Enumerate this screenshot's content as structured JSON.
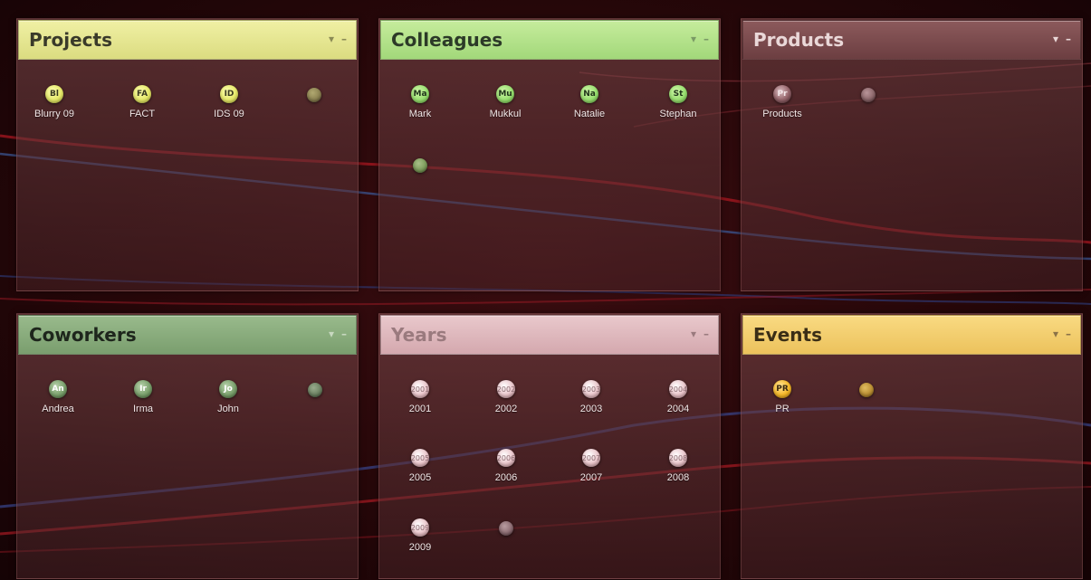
{
  "colors": {
    "projects": "#e6e68c",
    "colleagues": "#b2e28a",
    "products": "#7c4a4d",
    "coworkers": "#88ab7b",
    "years": "#ddb8bd",
    "events": "#f3cc6a"
  },
  "controls": {
    "dropdown_icon": "▾",
    "minimize_icon": "–"
  },
  "panels": {
    "projects": {
      "title": "Projects",
      "items": [
        {
          "abbr": "Bl",
          "label": "Blurry 09"
        },
        {
          "abbr": "FA",
          "label": "FACT"
        },
        {
          "abbr": "ID",
          "label": "IDS 09"
        }
      ]
    },
    "colleagues": {
      "title": "Colleagues",
      "items": [
        {
          "abbr": "Ma",
          "label": "Mark"
        },
        {
          "abbr": "Mu",
          "label": "Mukkul"
        },
        {
          "abbr": "Na",
          "label": "Natalie"
        },
        {
          "abbr": "St",
          "label": "Stephan"
        }
      ]
    },
    "products": {
      "title": "Products",
      "items": [
        {
          "abbr": "Pr",
          "label": "Products"
        }
      ]
    },
    "coworkers": {
      "title": "Coworkers",
      "items": [
        {
          "abbr": "An",
          "label": "Andrea"
        },
        {
          "abbr": "Ir",
          "label": "Irma"
        },
        {
          "abbr": "Jo",
          "label": "John"
        }
      ]
    },
    "years": {
      "title": "Years",
      "items": [
        {
          "abbr": "2001",
          "label": "2001"
        },
        {
          "abbr": "2002",
          "label": "2002"
        },
        {
          "abbr": "2003",
          "label": "2003"
        },
        {
          "abbr": "2004",
          "label": "2004"
        },
        {
          "abbr": "2005",
          "label": "2005"
        },
        {
          "abbr": "2006",
          "label": "2006"
        },
        {
          "abbr": "2007",
          "label": "2007"
        },
        {
          "abbr": "2008",
          "label": "2008"
        },
        {
          "abbr": "2009",
          "label": "2009"
        }
      ]
    },
    "events": {
      "title": "Events",
      "items": [
        {
          "abbr": "PR",
          "label": "PR"
        }
      ]
    }
  }
}
